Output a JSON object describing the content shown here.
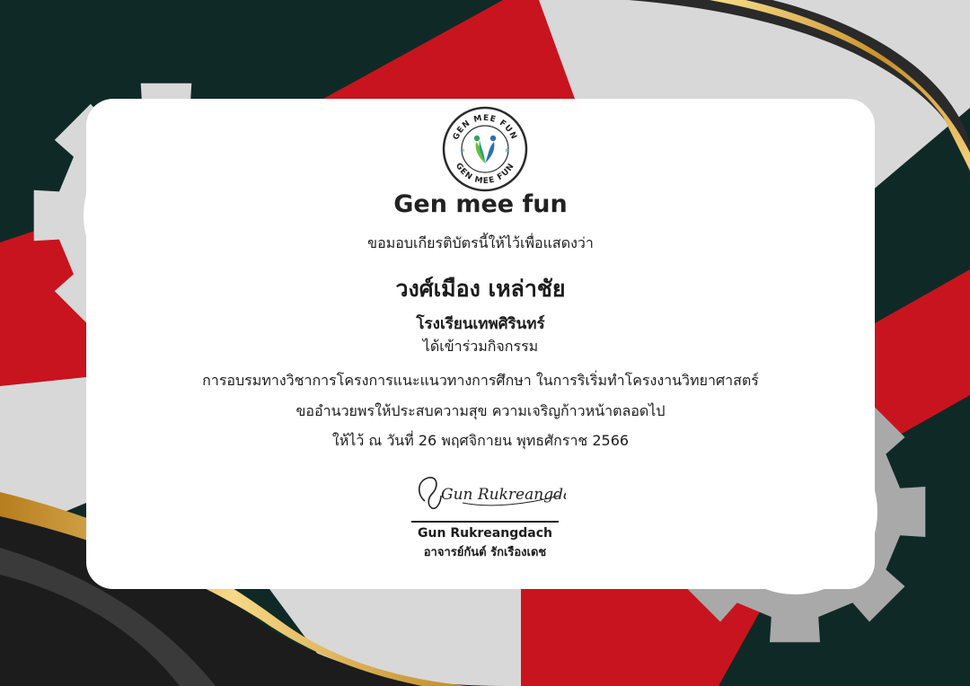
{
  "logo": {
    "ring_text_top": "GEN MEE FUN",
    "ring_text_bottom": "GEN MEE FUN"
  },
  "certificate": {
    "brand": "Gen mee fun",
    "intro": "ขอมอบเกียรติบัตรนี้ให้ไว้เพื่อแสดงว่า",
    "recipient": "วงศ์เมือง เหล่าชัย",
    "school": "โรงเรียนเทพศิรินทร์",
    "joined_text": "ได้เข้าร่วมกิจกรรม",
    "activity": "การอบรมทางวิชาการโครงการแนะแนวทางการศึกษา ในการริเริ่มทำโครงงานวิทยาศาสตร์",
    "wish": "ขออำนวยพรให้ประสบความสุข ความเจริญก้าวหน้าตลอดไป",
    "date": "ให้ไว้ ณ วันที่ 26 พฤศจิกายน พุทธศักราช 2566"
  },
  "signature": {
    "script": "Gun Rukreangdach",
    "name": "Gun Rukreangdach",
    "title": "อาจารย์กันต์ รักเรืองเดช"
  },
  "colors": {
    "dark_green": "#0f2a26",
    "red": "#c8141e",
    "gray": "#d6d6d6",
    "gold": "#d4a33b",
    "gear_light": "#d8d8d8",
    "gear_dark": "#a9a9a9"
  }
}
